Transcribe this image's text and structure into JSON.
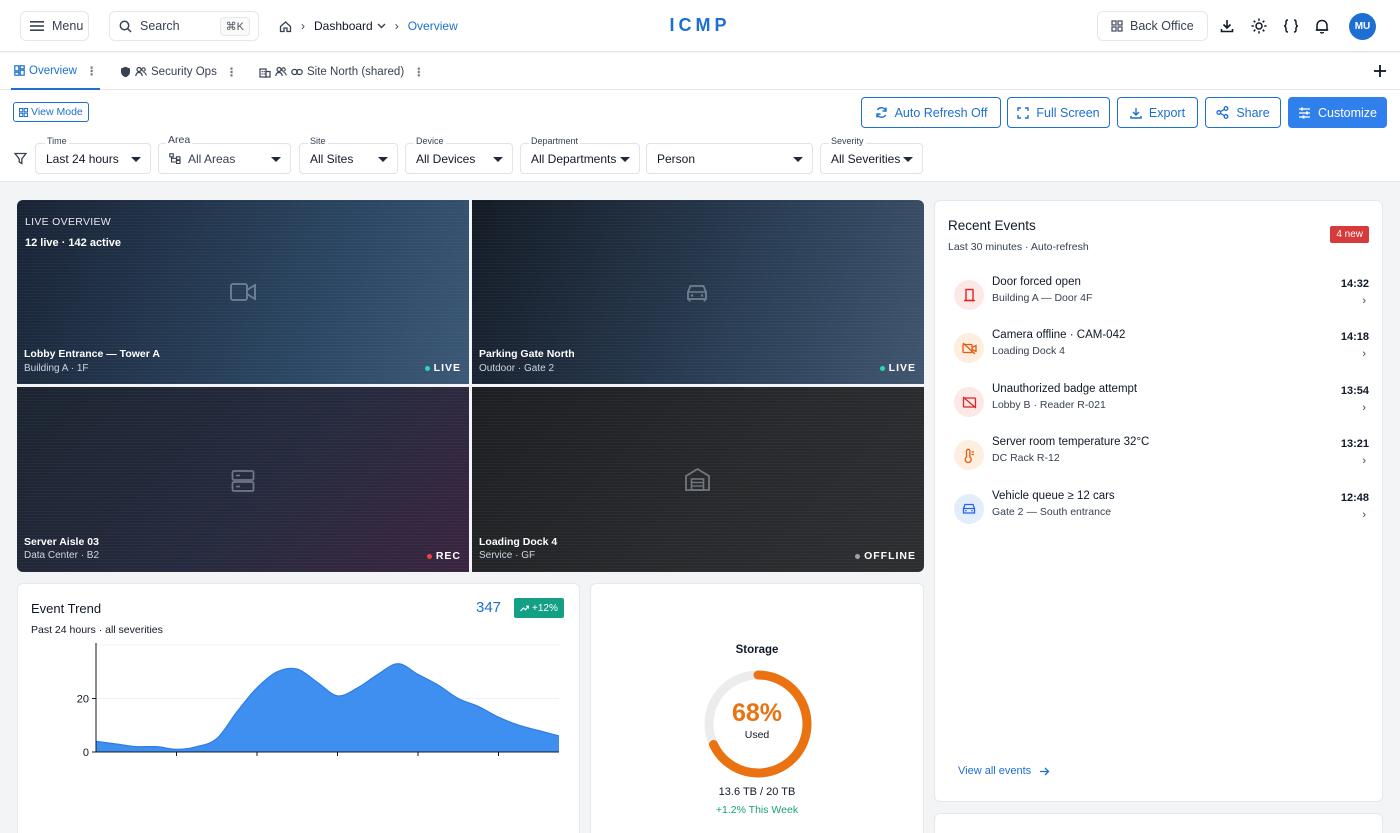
{
  "header": {
    "menu_label": "Menu",
    "search_label": "Search",
    "search_shortcut": "⌘K",
    "breadcrumb": {
      "dashboard": "Dashboard",
      "overview": "Overview"
    },
    "brand": "ICMP",
    "back_office_label": "Back Office",
    "avatar_initials": "MU"
  },
  "tabs": [
    {
      "label": "Overview"
    },
    {
      "label": "Security Ops"
    },
    {
      "label": "Site North (shared)"
    }
  ],
  "actions": {
    "view_mode": "View Mode",
    "auto_refresh": "Auto Refresh Off",
    "full_screen": "Full Screen",
    "export": "Export",
    "share": "Share",
    "customize": "Customize"
  },
  "filters": {
    "time": {
      "label": "Time",
      "value": "Last 24 hours"
    },
    "area": {
      "label": "Area",
      "value": "All Areas"
    },
    "site": {
      "label": "Site",
      "value": "All Sites"
    },
    "device": {
      "label": "Device",
      "value": "All Devices"
    },
    "department": {
      "label": "Department",
      "value": "All Departments"
    },
    "person": {
      "value": "Person"
    },
    "severity": {
      "label": "Severity",
      "value": "All Severities"
    }
  },
  "live": {
    "heading": "LIVE OVERVIEW",
    "summary": "12 live · 142 active",
    "cameras": [
      {
        "name": "Lobby Entrance — Tower A",
        "location": "Building A · 1F",
        "status": "LIVE",
        "icon": "video-camera-icon"
      },
      {
        "name": "Parking Gate North",
        "location": "Outdoor · Gate 2",
        "status": "LIVE",
        "icon": "car-icon"
      },
      {
        "name": "Server Aisle 03",
        "location": "Data Center · B2",
        "status": "REC",
        "icon": "server-icon"
      },
      {
        "name": "Loading Dock 4",
        "location": "Service · GF",
        "status": "OFFLINE",
        "icon": "warehouse-icon"
      }
    ]
  },
  "events": {
    "title": "Recent Events",
    "subtitle": "Last 30 minutes · Auto-refresh",
    "badge": "4 new",
    "items": [
      {
        "title": "Door forced open",
        "sub": "Building A — Door 4F",
        "time": "14:32",
        "icon": "door-icon",
        "color": "#dc2626"
      },
      {
        "title": "Camera offline · CAM-042",
        "sub": "Loading Dock 4",
        "time": "14:18",
        "icon": "video-off-icon",
        "color": "#ea580c"
      },
      {
        "title": "Unauthorized badge attempt",
        "sub": "Lobby B · Reader R-021",
        "time": "13:54",
        "icon": "badge-off-icon",
        "color": "#dc2626"
      },
      {
        "title": "Server room temperature 32°C",
        "sub": "DC Rack R-12",
        "time": "13:21",
        "icon": "thermometer-icon",
        "color": "#ea580c"
      },
      {
        "title": "Vehicle queue ≥ 12 cars",
        "sub": "Gate 2 — South entrance",
        "time": "12:48",
        "icon": "car-icon",
        "color": "#2563eb"
      }
    ],
    "view_all": "View all events"
  },
  "trend": {
    "title": "Event Trend",
    "subtitle": "Past 24 hours · all severities",
    "total": "347",
    "delta": "+12%"
  },
  "storage": {
    "title": "Storage",
    "percent_label": "68%",
    "used_label": "Used",
    "capacity": "13.6 TB / 20 TB",
    "weekly": "+1.2% This Week",
    "fraction": 0.68
  },
  "chart_data": {
    "type": "area",
    "title": "Event Trend",
    "x": [
      0,
      1,
      2,
      3,
      4,
      5,
      6,
      7,
      8,
      9,
      10,
      11,
      12,
      13,
      14,
      15,
      16,
      17,
      18,
      19,
      20,
      21,
      22,
      23
    ],
    "series": [
      {
        "values": [
          4,
          3,
          2,
          2,
          1,
          2,
          5,
          15,
          24,
          30,
          31,
          26,
          21,
          24,
          29,
          33,
          29,
          25,
          20,
          17,
          13,
          10,
          8,
          6
        ]
      }
    ],
    "yticks": [
      0,
      20
    ],
    "ylim": [
      0,
      40
    ],
    "color": "#3f8ff0",
    "xlabel": "",
    "ylabel": ""
  },
  "colors": {
    "accent": "#1d6fd1",
    "primary_button": "#2f80ed",
    "storage_ring": "#ea7211",
    "live_dot": "#2dd4bf",
    "rec_dot": "#ef4444",
    "offline_dot": "#9ca3af",
    "badge_new": "#d63a3a",
    "delta_badge": "#14a085"
  }
}
